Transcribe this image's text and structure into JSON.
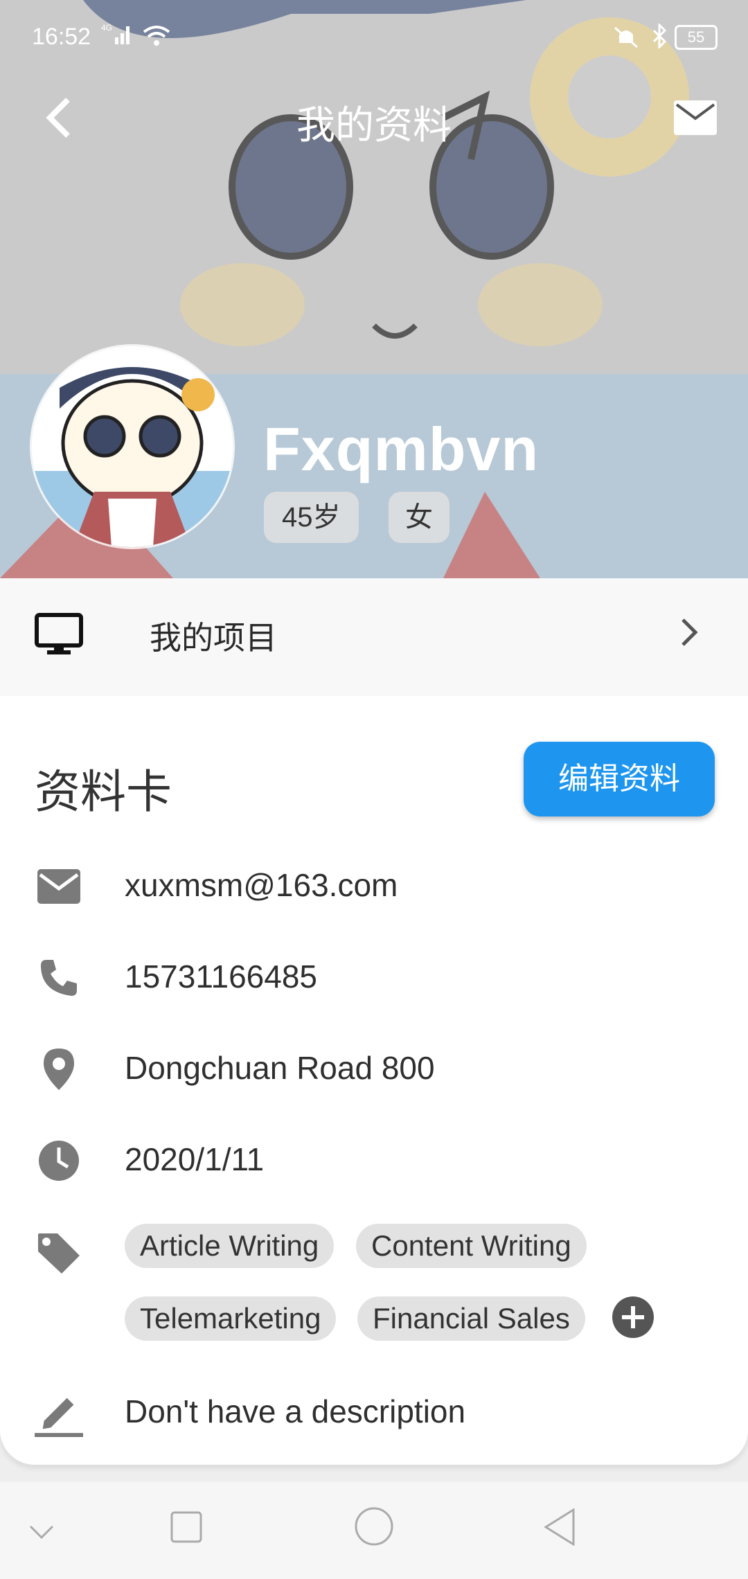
{
  "status_bar": {
    "time": "16:52",
    "network": "4G",
    "battery": "55"
  },
  "topbar": {
    "title": "我的资料",
    "back_icon": "back-arrow-icon",
    "mail_icon": "mail-icon"
  },
  "profile": {
    "name": "Fxqmbvn",
    "age": "45岁",
    "gender": "女"
  },
  "projects": {
    "label": "我的项目",
    "icon": "monitor-icon"
  },
  "card": {
    "title": "资料卡",
    "edit_label": "编辑资料",
    "email": "xuxmsm@163.com",
    "phone": "15731166485",
    "address": "Dongchuan Road 800",
    "date": "2020/1/11",
    "tags": [
      "Article Writing",
      "Content Writing",
      "Telemarketing",
      "Financial Sales"
    ],
    "description": "Don't have a description"
  },
  "colors": {
    "accent": "#1e96f0",
    "icon_gray": "#7a7a7a"
  }
}
